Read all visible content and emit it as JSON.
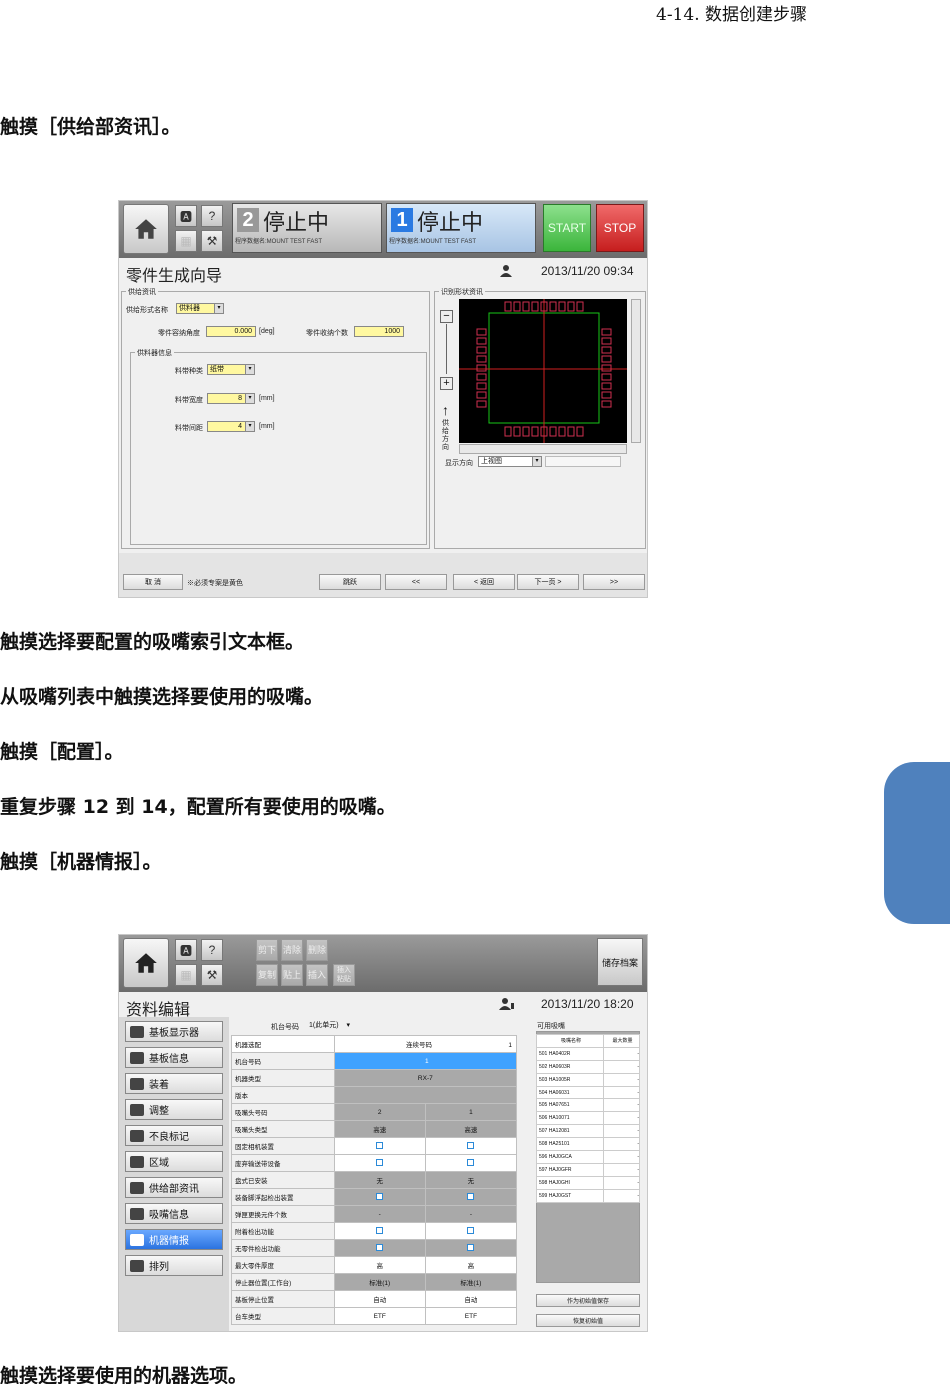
{
  "header": "4-14. 数据创建步骤",
  "steps": [
    "触摸［供给部资讯］。",
    "触摸选择要配置的吸嘴索引文本框。",
    "从吸嘴列表中触摸选择要使用的吸嘴。",
    "触摸［配置］。",
    "重复步骤 12 到 14，配置所有要使用的吸嘴。",
    "触摸［机器情报］。",
    "触摸选择要使用的机器选项。"
  ],
  "screen1": {
    "panel2": {
      "num": "2",
      "status": "停止中",
      "sub": "程序数据名:MOUNT TEST FAST"
    },
    "panel1": {
      "num": "1",
      "status": "停止中",
      "sub": "程序数据名:MOUNT TEST FAST"
    },
    "start": "START",
    "stop": "STOP",
    "title": "零件生成向导",
    "datetime": "2013/11/20 09:34",
    "feeder_group": "供给资讯",
    "feeder_type_label": "供给形式名称",
    "feeder_type_value": "供料器",
    "angle_label": "零件容纳角度",
    "angle_value": "0.000",
    "angle_unit": "[deg]",
    "count_label": "零件收纳个数",
    "count_value": "1000",
    "feeder_info_group": "供料器信息",
    "tape_type_label": "料带种类",
    "tape_type_value": "纸带",
    "tape_width_label": "料带宽度",
    "tape_width_value": "8",
    "tape_width_unit": "[mm]",
    "pitch_label": "料带间距",
    "pitch_value": "4",
    "pitch_unit": "[mm]",
    "recog_group": "识别形状资讯",
    "feed_dir": "供给方向",
    "view_label": "显示方向",
    "view_value": "上视图",
    "nav": {
      "cancel": "取 消",
      "note": "※必须专案是黄色",
      "jump": "跳跃",
      "first": "<<",
      "back": "< 返回",
      "next": "下一页 >",
      "last": ">>"
    }
  },
  "screen2": {
    "toolbar": {
      "cut": "剪下",
      "clear": "清除",
      "delete": "删除",
      "copy": "复制",
      "paste": "贴上",
      "insert": "插入",
      "insert_paste": "插入粘贴"
    },
    "save": "储存档案",
    "title": "资料编辑",
    "datetime": "2013/11/20 18:20",
    "machine_no_label": "机台号码",
    "machine_no_value": "1(此单元)",
    "side_items": [
      "基板显示器",
      "基板信息",
      "装着",
      "调整",
      "不良标记",
      "区域",
      "供给部资讯",
      "吸嘴信息",
      "机器情报",
      "排列"
    ],
    "table_header": {
      "c1": "机器选配",
      "c2": "连续号码",
      "c3": "1"
    },
    "rows": [
      {
        "label": "机台号码",
        "v": "1"
      },
      {
        "label": "机器类型",
        "v": "RX-7"
      },
      {
        "label": "版本",
        "v": ""
      },
      {
        "label": "吸嘴头号码",
        "a": "2",
        "b": "1"
      },
      {
        "label": "吸嘴头类型",
        "a": "高速",
        "b": "高速"
      },
      {
        "label": "固定相机装置"
      },
      {
        "label": "废弃输送带设备"
      },
      {
        "label": "盘式已安装",
        "a": "无",
        "b": "无"
      },
      {
        "label": "装备脚浮起检出装置"
      },
      {
        "label": "弹匣更换元件个数",
        "a": "-",
        "b": "-"
      },
      {
        "label": "附着检出功能"
      },
      {
        "label": "无零件检出功能"
      },
      {
        "label": "最大零件厚度",
        "a": "高",
        "b": "高"
      },
      {
        "label": "停止器位置(工作台)",
        "a": "标准(1)",
        "b": "标准(1)"
      },
      {
        "label": "基板停止位置",
        "a": "自动",
        "b": "自动"
      },
      {
        "label": "台车类型",
        "a": "ETF",
        "b": "ETF"
      }
    ],
    "nozzle_panel": "可用吸嘴",
    "nozzle_header": {
      "name": "吸嘴名称",
      "max": "最大数量"
    },
    "nozzles": [
      {
        "name": "501 HA0402R",
        "max": "-"
      },
      {
        "name": "502 HA0603R",
        "max": "-"
      },
      {
        "name": "503 HA1005R",
        "max": "-"
      },
      {
        "name": "504 HA06031",
        "max": "-"
      },
      {
        "name": "505 HA07651",
        "max": "-"
      },
      {
        "name": "506 HA10071",
        "max": "-"
      },
      {
        "name": "507 HA12081",
        "max": "-"
      },
      {
        "name": "508 HA25101",
        "max": "-"
      },
      {
        "name": "596 HAJ0GCA",
        "max": "-"
      },
      {
        "name": "597 HAJ0GFR",
        "max": "-"
      },
      {
        "name": "598 HAJ0GHI",
        "max": "-"
      },
      {
        "name": "599 HAJ0GST",
        "max": "-"
      }
    ],
    "save_initial": "作为初始值保存",
    "restore_initial": "恢复初始值"
  }
}
